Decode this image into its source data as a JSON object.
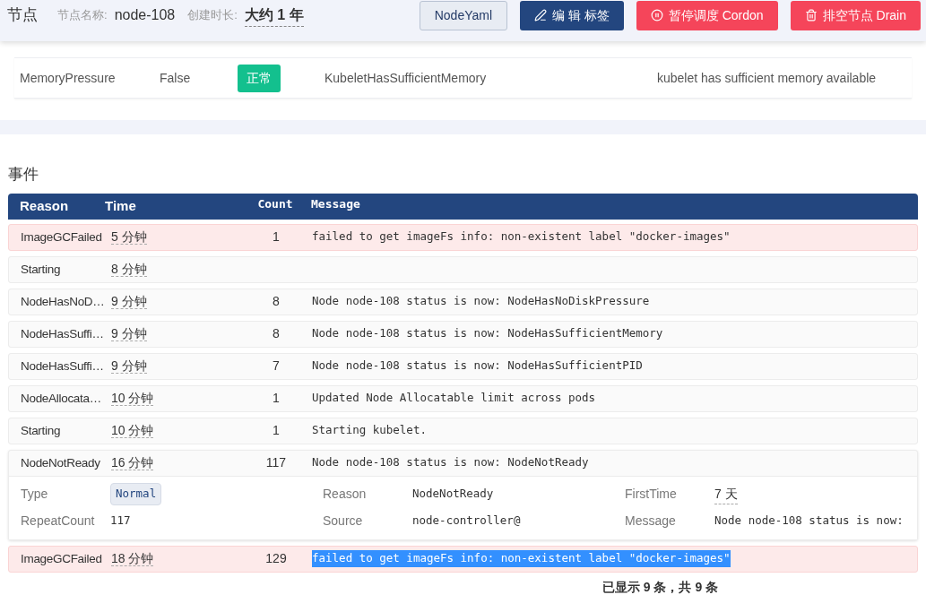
{
  "header": {
    "title": "节点",
    "name_label": "节点名称:",
    "name_value": "node-108",
    "age_label": "创建时长:",
    "age_value": "大约 1 年",
    "buttons": [
      {
        "label": "NodeYaml",
        "kind": "plain"
      },
      {
        "label": "编 辑 标签",
        "kind": "edit"
      },
      {
        "label": "暂停调度 Cordon",
        "kind": "cordon"
      },
      {
        "label": "排空节点 Drain",
        "kind": "drain"
      }
    ]
  },
  "conditions": [
    {
      "type": "MemoryPressure",
      "status": "False",
      "state": "正常",
      "reason": "KubeletHasSufficientMemory",
      "message": "kubelet has sufficient memory available"
    }
  ],
  "events": {
    "title": "事件",
    "columns": [
      "Reason",
      "Time",
      "Count",
      "Message"
    ],
    "rows": [
      {
        "kind": "warning",
        "reason": "ImageGCFailed",
        "time": "5 分钟",
        "count": "1",
        "message": "failed to get imageFs info: non-existent label \"docker-images\"",
        "highlighted": false
      },
      {
        "kind": "normal",
        "reason": "Starting",
        "time": "8 分钟"
      },
      {
        "kind": "normal",
        "reason": "NodeHasNoD…",
        "time": "9 分钟",
        "count": "8",
        "message": "Node node-108 status is now: NodeHasNoDiskPressure",
        "highlighted": false
      },
      {
        "kind": "normal",
        "reason": "NodeHasSuffi…",
        "time": "9 分钟",
        "count": "8",
        "message": "Node node-108 status is now: NodeHasSufficientMemory",
        "highlighted": false
      },
      {
        "kind": "normal",
        "reason": "NodeHasSuffi…",
        "time": "9 分钟",
        "count": "7",
        "message": "Node node-108 status is now: NodeHasSufficientPID",
        "highlighted": false
      },
      {
        "kind": "normal",
        "reason": "NodeAllocata…",
        "time": "10 分钟",
        "count": "1",
        "message": "Updated Node Allocatable limit across pods",
        "highlighted": false
      },
      {
        "kind": "normal",
        "reason": "Starting",
        "time": "10 分钟",
        "count": "1",
        "message": "Starting kubelet.",
        "highlighted": false
      },
      {
        "kind": "normal",
        "reason": "NodeNotReady",
        "time": "16 分钟",
        "count": "117",
        "message": "Node node-108 status is now: NodeNotReady",
        "highlighted": false,
        "expanded": true,
        "details": [
          {
            "label": "Type",
            "value": "Normal",
            "kind": "badge"
          },
          {
            "label": "Reason",
            "value": "NodeNotReady",
            "kind": "mono"
          },
          {
            "label": "FirstTime",
            "value": "7 天",
            "kind": "time"
          },
          {
            "label": "RepeatCount",
            "value": "117",
            "kind": "mono"
          },
          {
            "label": "Source",
            "value": "node-controller@",
            "kind": "mono"
          },
          {
            "label": "Message",
            "value": "Node node-108 status is now:",
            "kind": "mono"
          }
        ]
      },
      {
        "kind": "warning",
        "reason": "ImageGCFailed",
        "time": "18 分钟",
        "count": "129",
        "message": "failed to get imageFs info: non-existent label \"docker-images\"",
        "highlighted": true
      }
    ],
    "footer": "已显示 9 条，共 9 条"
  }
}
